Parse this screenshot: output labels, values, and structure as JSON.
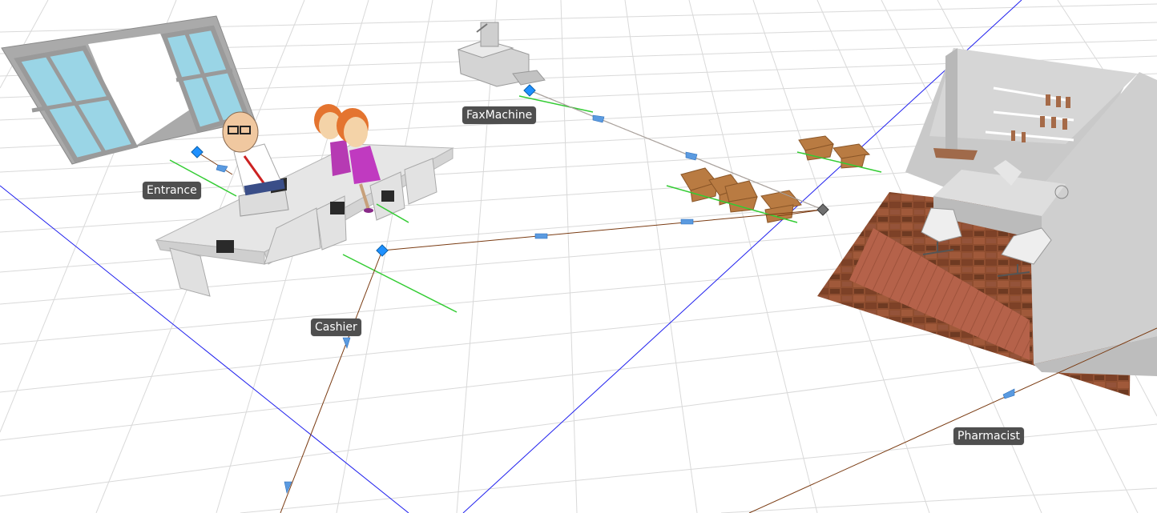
{
  "labels": {
    "entrance": "Entrance",
    "cashier": "Cashier",
    "fax_machine": "FaxMachine",
    "pharmacist": "Pharmacist"
  },
  "colors": {
    "background": "#ffffff",
    "grid": "#d8d8d8",
    "axis": "#1a1aff",
    "path": "#7a3b12",
    "node": "#1e90ff",
    "arrow": "#4a90d9",
    "range": "#22cc22",
    "label_bg": "#4f4f4f",
    "floor_wood": "#8b4a2b",
    "box": "#b87838",
    "glass": "#97d4e4"
  },
  "icons": [
    "entrance-node-icon",
    "cashier-node-icon",
    "fax-node-icon",
    "sink-node-icon",
    "flow-arrow-icon"
  ]
}
